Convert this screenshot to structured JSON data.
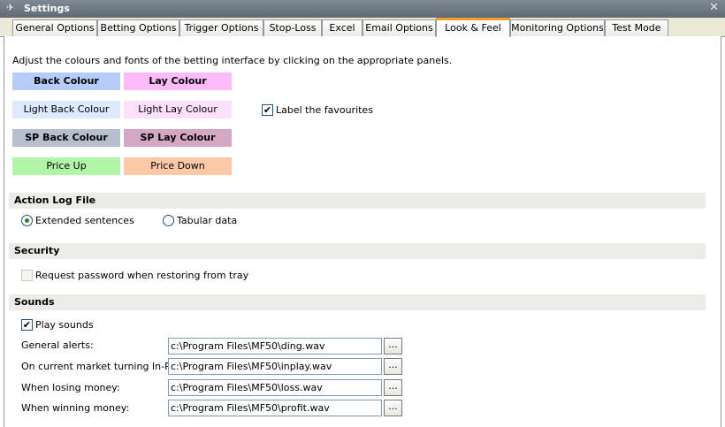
{
  "window": {
    "title": "Settings",
    "close": "✕",
    "pin": "✈"
  },
  "tabs": [
    "General Options",
    "Betting Options",
    "Trigger Options",
    "Stop-Loss",
    "Excel",
    "Email Options",
    "Look & Feel",
    "Monitoring Options",
    "Test Mode"
  ],
  "active_tab": "Look & Feel",
  "look": {
    "intro": "Adjust the colours and fonts of the betting interface by clicking on the appropriate panels.",
    "back_colour": "Back Colour",
    "lay_colour": "Lay Colour",
    "light_back_colour": "Light Back Colour",
    "light_lay_colour": "Light Lay Colour",
    "sp_back_colour": "SP Back Colour",
    "sp_lay_colour": "SP Lay Colour",
    "price_up": "Price Up",
    "price_down": "Price Down",
    "label_favourites": "Label the favourites",
    "label_favourites_checked": true
  },
  "colors": {
    "back": "#b5cdf8",
    "lay": "#fcbcfa",
    "light_back": "#dde9fc",
    "light_lay": "#fce0fc",
    "sp_back": "#b5bfd0",
    "sp_lay": "#d4a8c4",
    "price_up": "#b2f4a8",
    "price_down": "#fcc8a8"
  },
  "action_log": {
    "heading": "Action Log File",
    "option_extended": "Extended sentences",
    "option_tabular": "Tabular data",
    "selected": "Extended sentences"
  },
  "security": {
    "heading": "Security",
    "request_password": "Request password when restoring from tray",
    "request_password_checked": false
  },
  "sounds": {
    "heading": "Sounds",
    "play_sounds": "Play sounds",
    "play_sounds_checked": true,
    "browse_label": "...",
    "rows": [
      {
        "label": "General alerts:",
        "value": "c:\\Program Files\\MF50\\ding.wav"
      },
      {
        "label": "On current market turning In-Play:",
        "value": "c:\\Program Files\\MF50\\inplay.wav"
      },
      {
        "label": "When losing money:",
        "value": "c:\\Program Files\\MF50\\loss.wav"
      },
      {
        "label": "When winning money:",
        "value": "c:\\Program Files\\MF50\\profit.wav"
      }
    ]
  }
}
